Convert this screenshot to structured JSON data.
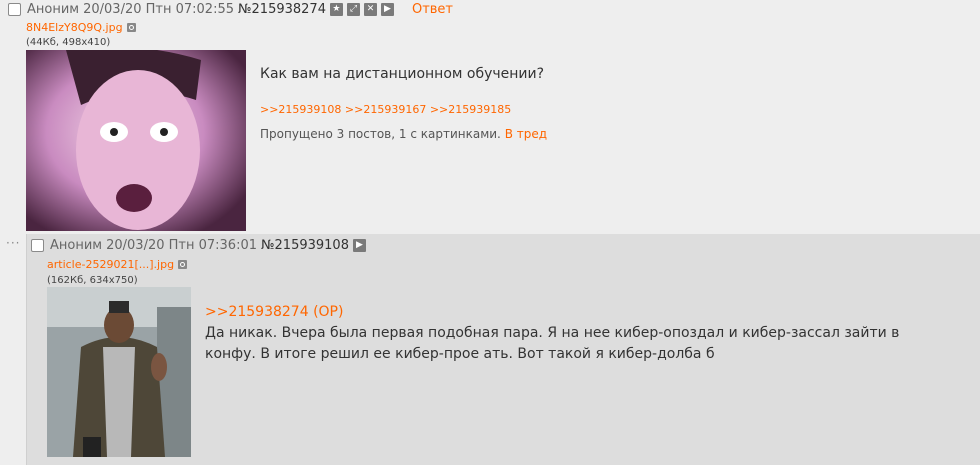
{
  "op": {
    "author": "Аноним",
    "date": "20/03/20 Птн 07:02:55",
    "number": "№215938274",
    "reply_label": "Ответ",
    "file_name": "8N4ElzY8Q9Q.jpg",
    "file_meta": "(44Кб, 498x410)",
    "text": "Как вам на дистанционном обучении?",
    "reply_refs": [
      ">>215939108",
      ">>215939167",
      ">>215939185"
    ],
    "omitted_text": "Пропущено 3 постов, 1 с картинками.",
    "to_thread_label": "В тред",
    "icons": [
      "star-icon",
      "expand-icon",
      "hide-icon",
      "play-icon",
      "search-image-icon"
    ]
  },
  "reply": {
    "dots": "···",
    "author": "Аноним",
    "date": "20/03/20 Птн 07:36:01",
    "number": "№215939108",
    "file_name": "article-2529021[...].jpg",
    "file_meta": "(162Кб, 634x750)",
    "quote_link": ">>215938274 (OP)",
    "text": "Да никак. Вчера была первая подобная пара. Я на нее кибер-опоздал и кибер-зассал зайти в конфу. В итоге решил ее кибер-прое  ать. Вот такой я кибер-долба  б"
  },
  "colors": {
    "background": "#eeeeee",
    "reply_background": "#dddddd",
    "accent": "#ff6600"
  }
}
